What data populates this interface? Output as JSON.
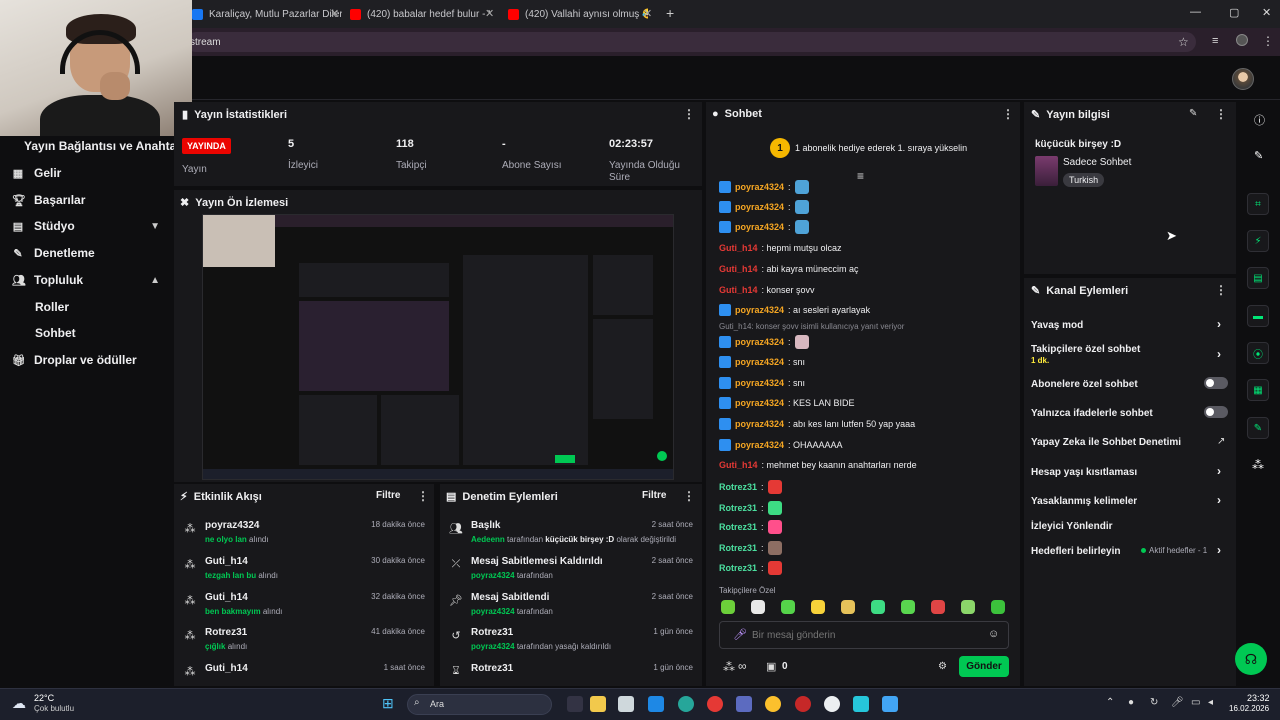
{
  "browser": {
    "tabs": [
      {
        "label": "Karaliçay, Mutlu Pazarlar Diler...",
        "color": "#1877f2"
      },
      {
        "label": "(420) babalar hedef bulur - You...",
        "color": "#ff0000"
      },
      {
        "label": "(420) Vallahi aynısı olmuş 😂😂",
        "color": "#ff0000"
      }
    ],
    "new_tab": "+",
    "address": "stream",
    "window_controls": {
      "min": "—",
      "max": "▢",
      "close": "✕"
    }
  },
  "sidebar": {
    "title": "Yayın Bağlantısı ve Anahtarı",
    "items": [
      {
        "label": "Gelir",
        "icon": "chart-icon"
      },
      {
        "label": "Başarılar",
        "icon": "trophy-icon"
      },
      {
        "label": "Stüdyo",
        "icon": "studio-icon"
      },
      {
        "label": "Denetleme",
        "icon": "wrench-icon"
      },
      {
        "label": "Topluluk",
        "icon": "people-icon"
      },
      {
        "label": "Droplar ve ödüller",
        "icon": "gift-icon"
      }
    ],
    "subitems": [
      "Roller",
      "Sohbet"
    ]
  },
  "stats": {
    "title": "Yayın İstatistikleri",
    "live_badge": "YAYINDA",
    "live_label": "Yayın",
    "items": [
      {
        "value": "5",
        "label": "İzleyici"
      },
      {
        "value": "118",
        "label": "Takipçi"
      },
      {
        "value": "-",
        "label": "Abone Sayısı"
      },
      {
        "value": "02:23:57",
        "label": "Yayında Olduğu Süre"
      }
    ]
  },
  "preview": {
    "title": "Yayın Ön İzlemesi"
  },
  "activity": {
    "title": "Etkinlik Akışı",
    "filter": "Filtre",
    "rows": [
      {
        "user": "poyraz4324",
        "item": "ne olyo lan",
        "suffix": "alındı",
        "time": "18 dakika önce"
      },
      {
        "user": "Guti_h14",
        "item": "tezgah lan bu",
        "suffix": "alındı",
        "time": "30 dakika önce"
      },
      {
        "user": "Guti_h14",
        "item": "ben bakmayım",
        "suffix": "alındı",
        "time": "32 dakika önce"
      },
      {
        "user": "Rotrez31",
        "item": "çığlık",
        "suffix": "alındı",
        "time": "41 dakika önce"
      },
      {
        "user": "Guti_h14",
        "item": "",
        "suffix": "",
        "time": "1 saat önce"
      }
    ]
  },
  "moderation": {
    "title": "Denetim Eylemleri",
    "filter": "Filtre",
    "rows": [
      {
        "title": "Başlık",
        "actor": "Aedeenn",
        "text": "tarafından",
        "extra": "küçücük birşey :D",
        "extra2": "olarak değiştirildi",
        "time": "2 saat önce",
        "icon": "people-icon"
      },
      {
        "title": "Mesaj Sabitlemesi Kaldırıldı",
        "actor": "poyraz4324",
        "text": "tarafından",
        "extra": "",
        "extra2": "",
        "time": "2 saat önce",
        "icon": "unpin-icon"
      },
      {
        "title": "Mesaj Sabitlendi",
        "actor": "poyraz4324",
        "text": "tarafından",
        "extra": "",
        "extra2": "",
        "time": "2 saat önce",
        "icon": "pin-icon"
      },
      {
        "title": "Rotrez31",
        "actor": "poyraz4324",
        "text": "tarafından yasağı kaldırıldı",
        "extra": "",
        "extra2": "",
        "time": "1 gün önce",
        "icon": "undo-icon"
      },
      {
        "title": "Rotrez31",
        "actor": "",
        "text": "",
        "extra": "",
        "extra2": "",
        "time": "1 gün önce",
        "icon": "hourglass-icon"
      }
    ]
  },
  "chat": {
    "title": "Sohbet",
    "hype_rank": "1",
    "hype_text": "1 abonelik hediye ederek 1. sıraya yükselin",
    "messages": [
      {
        "user": "poyraz4324",
        "text": ":",
        "color": "#f5a623",
        "badge": true,
        "emote": true
      },
      {
        "user": "poyraz4324",
        "text": ":",
        "color": "#f5a623",
        "badge": true,
        "emote": true
      },
      {
        "user": "poyraz4324",
        "text": ":",
        "color": "#f5a623",
        "badge": true,
        "emote": true
      },
      {
        "user": "Guti_h14",
        "text": ": hepmi mutşu olcaz",
        "color": "#e53935",
        "badge": false,
        "emote": false
      },
      {
        "user": "Guti_h14",
        "text": ": abi kayra müneccim aç",
        "color": "#e53935",
        "badge": false,
        "emote": false
      },
      {
        "user": "Guti_h14",
        "text": ": konser şovv",
        "color": "#e53935",
        "badge": false,
        "emote": false
      },
      {
        "user": "poyraz4324",
        "text": ": aı sesleri ayarlayak",
        "color": "#f5a623",
        "badge": true,
        "emote": false
      },
      {
        "user": "poyraz4324",
        "text": ":",
        "color": "#f5a623",
        "badge": true,
        "emote": true
      },
      {
        "user": "poyraz4324",
        "text": ": snı",
        "color": "#f5a623",
        "badge": true,
        "emote": false
      },
      {
        "user": "poyraz4324",
        "text": ": snı",
        "color": "#f5a623",
        "badge": true,
        "emote": false
      },
      {
        "user": "poyraz4324",
        "text": ": KES LAN BIDE",
        "color": "#f5a623",
        "badge": true,
        "emote": false
      },
      {
        "user": "poyraz4324",
        "text": ": abı kes lanı lutfen 50 yap yaaa",
        "color": "#f5a623",
        "badge": true,
        "emote": false
      },
      {
        "user": "poyraz4324",
        "text": ": OHAAAAAA",
        "color": "#f5a623",
        "badge": true,
        "emote": false
      },
      {
        "user": "Guti_h14",
        "text": ": mehmet bey kaanın anahtarları nerde",
        "color": "#e53935",
        "badge": false,
        "emote": false
      },
      {
        "user": "Rotrez31",
        "text": ":",
        "color": "#4ce0a0",
        "badge": false,
        "emote": true
      },
      {
        "user": "Rotrez31",
        "text": ":",
        "color": "#4ce0a0",
        "badge": false,
        "emote": true
      },
      {
        "user": "Rotrez31",
        "text": ":",
        "color": "#4ce0a0",
        "badge": false,
        "emote": true
      },
      {
        "user": "Rotrez31",
        "text": ":",
        "color": "#4ce0a0",
        "badge": false,
        "emote": true
      },
      {
        "user": "Rotrez31",
        "text": ":",
        "color": "#4ce0a0",
        "badge": false,
        "emote": true
      }
    ],
    "reply_note": "Guti_h14: konser şovv isimli kullanıcıya yanıt veriyor",
    "followers_only": "Takipçilere Özel",
    "emoji_colors": [
      "#6ccf3a",
      "#e8e8e8",
      "#55d34a",
      "#f7d23a",
      "#e6c25a",
      "#3ddc84",
      "#59d64f",
      "#e04545",
      "#8bd66a",
      "#3cc23c"
    ],
    "input_placeholder": "Bir mesaj gönderin",
    "points": "∞",
    "bits": "0",
    "send": "Gönder"
  },
  "stream_info": {
    "title": "Yayın bilgisi",
    "stream_title": "küçücük birşey :D",
    "category": "Sadece Sohbet",
    "tag": "Turkish"
  },
  "channel_actions": {
    "title": "Kanal Eylemleri",
    "items": [
      {
        "label": "Yavaş mod",
        "sub": "",
        "control": "arrow"
      },
      {
        "label": "Takipçilere özel sohbet",
        "sub": "1 dk.",
        "control": "arrow"
      },
      {
        "label": "Abonelere özel sohbet",
        "sub": "",
        "control": "toggle"
      },
      {
        "label": "Yalnızca ifadelerle sohbet",
        "sub": "",
        "control": "toggle"
      },
      {
        "label": "Yapay Zeka ile Sohbet Denetimi",
        "sub": "",
        "control": "external"
      },
      {
        "label": "Hesap yaşı kısıtlaması",
        "sub": "",
        "control": "arrow"
      },
      {
        "label": "Yasaklanmış kelimeler",
        "sub": "",
        "control": "arrow"
      },
      {
        "label": "İzleyici Yönlendir",
        "sub": "",
        "control": "none"
      },
      {
        "label": "Hedefleri belirleyin",
        "sub": "",
        "control": "arrow"
      }
    ],
    "active_goals": "Aktif hedefler - 1"
  },
  "taskbar": {
    "weather_temp": "22°C",
    "weather_desc": "Çok bulutlu",
    "search": "Ara",
    "time": "23:32",
    "date": "16.02.2026"
  }
}
